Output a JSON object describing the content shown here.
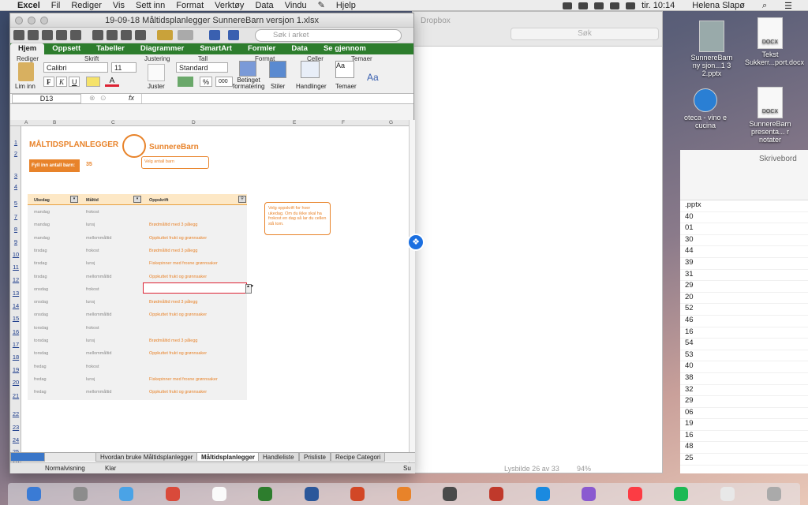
{
  "menubar": {
    "apple": "",
    "items": [
      "Excel",
      "Fil",
      "Rediger",
      "Vis",
      "Sett inn",
      "Format",
      "Verktøy",
      "Data",
      "Vindu",
      "",
      "Hjelp"
    ],
    "clock": "tir. 10:14",
    "user": "Helena Slapø"
  },
  "finder": {
    "title": "Dropbox",
    "search": "Søk",
    "status": "Lysbilde 26 av 33",
    "zoom": "94%"
  },
  "desktop": {
    "files": [
      {
        "name": "SunnereBarn ny sjon...1 3 2.pptx"
      },
      {
        "name": "Tekst Sukkerr...port.docx",
        "kind": "DOCX"
      },
      {
        "name": "oteca - vino e cucina",
        "kind": "WEBLOC"
      },
      {
        "name": "SunnereBarn presenta... r notater",
        "kind": "DOCX"
      }
    ],
    "folder": "Skrivebord",
    "list_top": ".pptx",
    "numbers": [
      "40",
      "01",
      "30",
      "44",
      "39",
      "31",
      "29",
      "20",
      "52",
      "46",
      "16",
      "54",
      "53",
      "40",
      "38",
      "32",
      "29",
      "06",
      "19",
      "16",
      "48",
      "25"
    ]
  },
  "excel": {
    "title": "19-09-18 Måltidsplanlegger SunnereBarn versjon 1.xlsx",
    "search_ph": "Søk i arket",
    "tabs": [
      "Hjem",
      "Oppsett",
      "Tabeller",
      "Diagrammer",
      "SmartArt",
      "Formler",
      "Data",
      "Se gjennom"
    ],
    "groups": {
      "rediger": "Rediger",
      "skrift": "Skrift",
      "justering": "Justering",
      "tall": "Tall",
      "format": "Format",
      "celler": "Celler",
      "temaer": "Temaer"
    },
    "btn": {
      "lim_inn": "Lim inn",
      "font": "Calibri",
      "size": "11",
      "bold": "F",
      "italic": "K",
      "underline": "U",
      "juster": "Juster",
      "numfmt": "Standard",
      "pct": "%",
      "thousands": "000",
      "betinget": "Betinget formatering",
      "stiler": "Stiler",
      "handlinger": "Handlinger",
      "temaer": "Temaer"
    },
    "namebox": "D13",
    "fx": "fx",
    "cols": [
      "A",
      "B",
      "C",
      "D",
      "E",
      "F",
      "G"
    ],
    "rows": [
      "1",
      "2",
      "3",
      "4",
      "5",
      "7",
      "8",
      "9",
      "10",
      "11",
      "12",
      "13",
      "14",
      "15",
      "16",
      "17",
      "18",
      "19",
      "20",
      "21",
      "22",
      "23",
      "24",
      "25",
      "26"
    ],
    "sheet": {
      "heading": "MÅLTIDSPLANLEGGER",
      "brand": "SunnereBarn",
      "fill_label": "Fyll inn antall barn:",
      "fill_value": "35",
      "velg": "Velg antall barn",
      "note": "Velg oppskrift for hver ukedag. Om du ikke skal ha frokost en dag så lar du cellen stå tom.",
      "headers": [
        "Ukedag",
        "Måltid",
        "Oppskrift"
      ],
      "data": [
        [
          "mandag",
          "frokost",
          ""
        ],
        [
          "mandag",
          "lunsj",
          "Brødmåltid med 3 pålegg"
        ],
        [
          "mandag",
          "mellommåltid",
          "Oppkuttet frukt og grønnsaker"
        ],
        [
          "tirsdag",
          "frokost",
          "Brødmåltid med 3 pålegg"
        ],
        [
          "tirsdag",
          "lunsj",
          "Fiskepinner med frosne grønnsaker"
        ],
        [
          "tirsdag",
          "mellommåltid",
          "Oppkuttet frukt og grønnsaker"
        ],
        [
          "onsdag",
          "frokost",
          ""
        ],
        [
          "onsdag",
          "lunsj",
          "Brødmåltid med 3 pålegg"
        ],
        [
          "onsdag",
          "mellommåltid",
          "Oppkuttet frukt og grønnsaker"
        ],
        [
          "torsdag",
          "frokost",
          ""
        ],
        [
          "torsdag",
          "lunsj",
          "Brødmåltid med 3 pålegg"
        ],
        [
          "torsdag",
          "mellommåltid",
          "Oppkuttet frukt og grønnsaker"
        ],
        [
          "fredag",
          "frokost",
          ""
        ],
        [
          "fredag",
          "lunsj",
          "Fiskepinner med frosne grønnsaker"
        ],
        [
          "fredag",
          "mellommåltid",
          "Oppkuttet frukt og grønnsaker"
        ]
      ]
    },
    "sheet_tabs": [
      "Hvordan bruke Måltidsplanlegger",
      "Måltidsplanlegger",
      "Handleliste",
      "Prisliste",
      "Recipe Categori"
    ],
    "status": {
      "view": "Normalvisning",
      "ready": "Klar",
      "sum": "Su"
    }
  }
}
